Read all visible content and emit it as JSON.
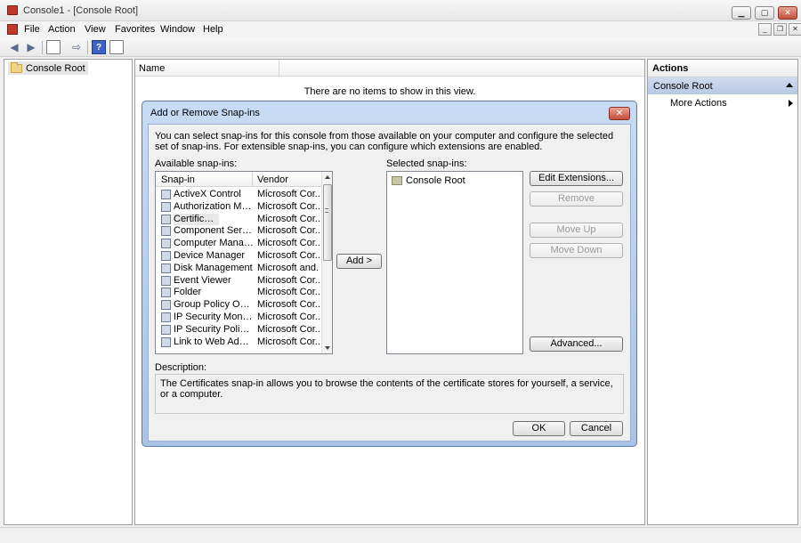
{
  "window": {
    "title": "Console1 - [Console Root]"
  },
  "menu": [
    "File",
    "Action",
    "View",
    "Favorites",
    "Window",
    "Help"
  ],
  "tree": {
    "root": "Console Root"
  },
  "center": {
    "column_name": "Name",
    "empty_message": "There are no items to show in this view."
  },
  "actions": {
    "header": "Actions",
    "section": "Console Root",
    "more": "More Actions"
  },
  "dialog": {
    "title": "Add or Remove Snap-ins",
    "intro": "You can select snap-ins for this console from those available on your computer and configure the selected set of snap-ins. For extensible snap-ins, you can configure which extensions are enabled.",
    "available_label": "Available snap-ins:",
    "selected_label": "Selected snap-ins:",
    "col_snapin": "Snap-in",
    "col_vendor": "Vendor",
    "snapins": [
      {
        "name": "ActiveX Control",
        "vendor": "Microsoft Cor..."
      },
      {
        "name": "Authorization Manager",
        "vendor": "Microsoft Cor..."
      },
      {
        "name": "Certificates",
        "vendor": "Microsoft Cor..."
      },
      {
        "name": "Component Services",
        "vendor": "Microsoft Cor..."
      },
      {
        "name": "Computer Managem...",
        "vendor": "Microsoft Cor..."
      },
      {
        "name": "Device Manager",
        "vendor": "Microsoft Cor..."
      },
      {
        "name": "Disk Management",
        "vendor": "Microsoft and..."
      },
      {
        "name": "Event Viewer",
        "vendor": "Microsoft Cor..."
      },
      {
        "name": "Folder",
        "vendor": "Microsoft Cor..."
      },
      {
        "name": "Group Policy Object ...",
        "vendor": "Microsoft Cor..."
      },
      {
        "name": "IP Security Monitor",
        "vendor": "Microsoft Cor..."
      },
      {
        "name": "IP Security Policy M...",
        "vendor": "Microsoft Cor..."
      },
      {
        "name": "Link to Web Address",
        "vendor": "Microsoft Cor..."
      }
    ],
    "selected_item": "Console Root",
    "add_button": "Add >",
    "edit_extensions": "Edit Extensions...",
    "remove": "Remove",
    "move_up": "Move Up",
    "move_down": "Move Down",
    "advanced": "Advanced...",
    "description_label": "Description:",
    "description": "The Certificates snap-in allows you to browse the contents of the certificate stores for yourself, a service, or a computer.",
    "ok": "OK",
    "cancel": "Cancel"
  }
}
